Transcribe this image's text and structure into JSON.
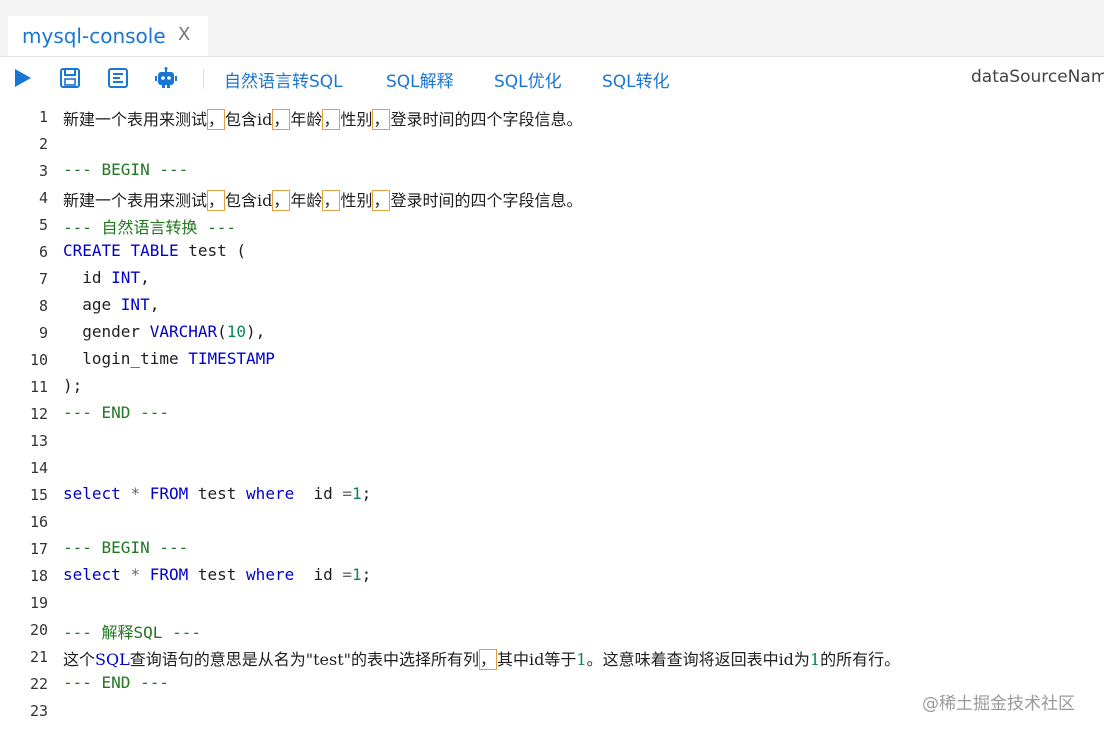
{
  "tab": {
    "title": "mysql-console",
    "close": "X"
  },
  "toolbar": {
    "icons": [
      "run-icon",
      "save-icon",
      "format-icon",
      "robot-icon"
    ],
    "links": [
      "自然语言转SQL",
      "SQL解释",
      "SQL优化",
      "SQL转化"
    ],
    "datasource_label": "dataSourceName"
  },
  "editor": {
    "line_numbers": [
      "1",
      "2",
      "3",
      "4",
      "5",
      "6",
      "7",
      "8",
      "9",
      "10",
      "11",
      "12",
      "13",
      "14",
      "15",
      "16",
      "17",
      "18",
      "19",
      "20",
      "21",
      "22",
      "23"
    ],
    "lines": {
      "l1": [
        "新建一个表用来测试",
        "，",
        "包含id",
        "，",
        "年龄",
        "，",
        "性别",
        "，",
        "登录时间的四个字段信息。"
      ],
      "l3": "--- BEGIN ---",
      "l4": [
        "新建一个表用来测试",
        "，",
        "包含id",
        "，",
        "年龄",
        "，",
        "性别",
        "，",
        "登录时间的四个字段信息。"
      ],
      "l5": "--- 自然语言转换 ---",
      "l6": [
        "CREATE",
        " ",
        "TABLE",
        " test ("
      ],
      "l7": [
        "  id ",
        "INT",
        ","
      ],
      "l8": [
        "  age ",
        "INT",
        ","
      ],
      "l9": [
        "  gender ",
        "VARCHAR",
        "(",
        "10",
        "),"
      ],
      "l10": [
        "  login_time ",
        "TIMESTAMP"
      ],
      "l11": ");",
      "l12": "--- END ---",
      "l15": [
        "select",
        " ",
        "*",
        " ",
        "FROM",
        " test ",
        "where",
        "  id ",
        "=",
        "1",
        ";"
      ],
      "l17": "--- BEGIN ---",
      "l18": [
        "select",
        " ",
        "*",
        " ",
        "FROM",
        " test ",
        "where",
        "  id ",
        "=",
        "1",
        ";"
      ],
      "l20": "--- 解释SQL ---",
      "l21": [
        "这个",
        "SQL",
        "查询语句的意思是从名为\"test\"的表中选择所有列",
        "，",
        "其中id等于",
        "1",
        "。这意味着查询将返回表中id为",
        "1",
        "的所有行。"
      ],
      "l22": "--- END ---"
    }
  },
  "watermark": "@稀土掘金技术社区"
}
